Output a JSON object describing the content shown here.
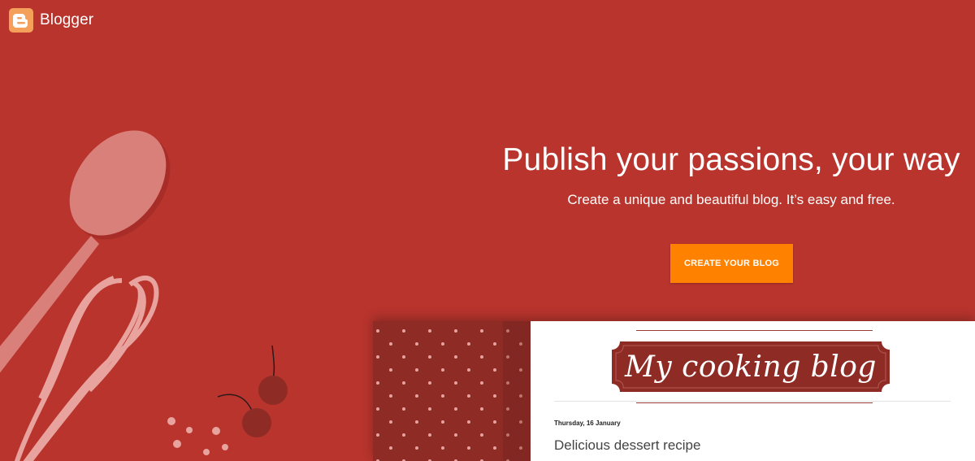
{
  "brand": {
    "name": "Blogger",
    "logo_color": "#f5a05a"
  },
  "hero": {
    "title": "Publish your passions, your way",
    "subtitle": "Create a unique and beautiful blog. It’s easy and free.",
    "cta_label": "CREATE YOUR BLOG"
  },
  "colors": {
    "background": "#b8342d",
    "cta": "#ff8100",
    "banner": "#8e2b25"
  },
  "preview": {
    "blog_title": "My cooking blog",
    "post_date": "Thursday, 16 January",
    "post_title": "Delicious dessert recipe"
  },
  "illustration": {
    "items": [
      "wooden-spoon-icon",
      "whisk-icon",
      "cherries-icon",
      "sprinkles-icon"
    ]
  }
}
